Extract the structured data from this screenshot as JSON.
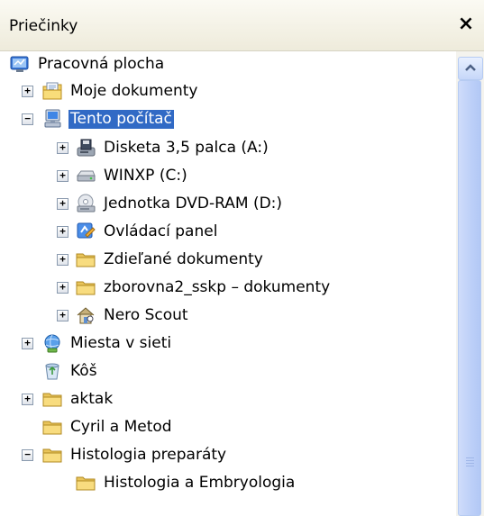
{
  "panel": {
    "title": "Priečinky",
    "close_glyph": "×"
  },
  "tree": [
    {
      "label": "Pracovná plocha",
      "icon": "desktop-icon",
      "level": 0,
      "expander": null
    },
    {
      "label": "Moje dokumenty",
      "icon": "my-documents-icon",
      "level": 1,
      "expander": "+"
    },
    {
      "label": "Tento počítač",
      "icon": "my-computer-icon",
      "level": 1,
      "expander": "−",
      "selected": true
    },
    {
      "label": "Disketa 3,5 palca (A:)",
      "icon": "floppy-drive-icon",
      "level": 2,
      "expander": "+"
    },
    {
      "label": "WINXP (C:)",
      "icon": "hard-drive-icon",
      "level": 2,
      "expander": "+"
    },
    {
      "label": "Jednotka DVD-RAM (D:)",
      "icon": "dvd-drive-icon",
      "level": 2,
      "expander": "+"
    },
    {
      "label": "Ovládací panel",
      "icon": "control-panel-icon",
      "level": 2,
      "expander": "+"
    },
    {
      "label": "Zdieľané dokumenty",
      "icon": "folder-icon",
      "level": 2,
      "expander": "+"
    },
    {
      "label": "zborovna2_sskp – dokumenty",
      "icon": "folder-icon",
      "level": 2,
      "expander": "+"
    },
    {
      "label": "Nero Scout",
      "icon": "nero-scout-icon",
      "level": 2,
      "expander": "+"
    },
    {
      "label": "Miesta v sieti",
      "icon": "network-places-icon",
      "level": 1,
      "expander": "+"
    },
    {
      "label": "Kôš",
      "icon": "recycle-bin-icon",
      "level": 1,
      "expander": null
    },
    {
      "label": "aktak",
      "icon": "folder-icon",
      "level": 1,
      "expander": "+"
    },
    {
      "label": "Cyril a Metod",
      "icon": "folder-icon",
      "level": 1,
      "expander": null
    },
    {
      "label": "Histologia preparáty",
      "icon": "folder-icon",
      "level": 1,
      "expander": "−"
    },
    {
      "label": "Histologia a Embryologia",
      "icon": "folder-icon",
      "level": 2,
      "expander": null
    }
  ],
  "scrollbar": {
    "up_arrow": "scroll-up-arrow-icon"
  }
}
